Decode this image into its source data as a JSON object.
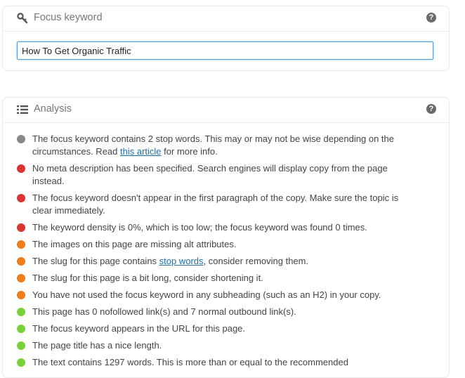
{
  "focus_panel": {
    "title": "Focus keyword",
    "icon": "key-icon",
    "help_icon": "help-icon",
    "help_glyph": "?",
    "input_value": "How To Get Organic Traffic"
  },
  "analysis_panel": {
    "title": "Analysis",
    "icon": "list-icon",
    "help_icon": "help-icon",
    "help_glyph": "?",
    "colors": {
      "na": "#888888",
      "bad": "#dc3232",
      "ok": "#ee7c1b",
      "good": "#7ad03a",
      "link": "#1e6fa9"
    },
    "results": [
      {
        "status": "na",
        "text_before": "The focus keyword contains 2 stop words. This may or may not be wise depending on the circumstances. Read ",
        "link": "this article",
        "text_after": " for more info."
      },
      {
        "status": "bad",
        "text_before": "No meta description has been specified. Search engines will display copy from the page instead.",
        "link": "",
        "text_after": ""
      },
      {
        "status": "bad",
        "text_before": "The focus keyword doesn't appear in the first paragraph of the copy. Make sure the topic is clear immediately.",
        "link": "",
        "text_after": ""
      },
      {
        "status": "bad",
        "text_before": "The keyword density is 0%, which is too low; the focus keyword was found 0 times.",
        "link": "",
        "text_after": ""
      },
      {
        "status": "ok",
        "text_before": "The images on this page are missing alt attributes.",
        "link": "",
        "text_after": ""
      },
      {
        "status": "ok",
        "text_before": "The slug for this page contains ",
        "link": "stop words",
        "text_after": ", consider removing them."
      },
      {
        "status": "ok",
        "text_before": "The slug for this page is a bit long, consider shortening it.",
        "link": "",
        "text_after": ""
      },
      {
        "status": "ok",
        "text_before": "You have not used the focus keyword in any subheading (such as an H2) in your copy.",
        "link": "",
        "text_after": ""
      },
      {
        "status": "good",
        "text_before": "This page has 0 nofollowed link(s) and 7 normal outbound link(s).",
        "link": "",
        "text_after": ""
      },
      {
        "status": "good",
        "text_before": "The focus keyword appears in the URL for this page.",
        "link": "",
        "text_after": ""
      },
      {
        "status": "good",
        "text_before": "The page title has a nice length.",
        "link": "",
        "text_after": ""
      },
      {
        "status": "good",
        "text_before": "The text contains 1297 words. This is more than or equal to the recommended",
        "link": "",
        "text_after": ""
      }
    ]
  }
}
